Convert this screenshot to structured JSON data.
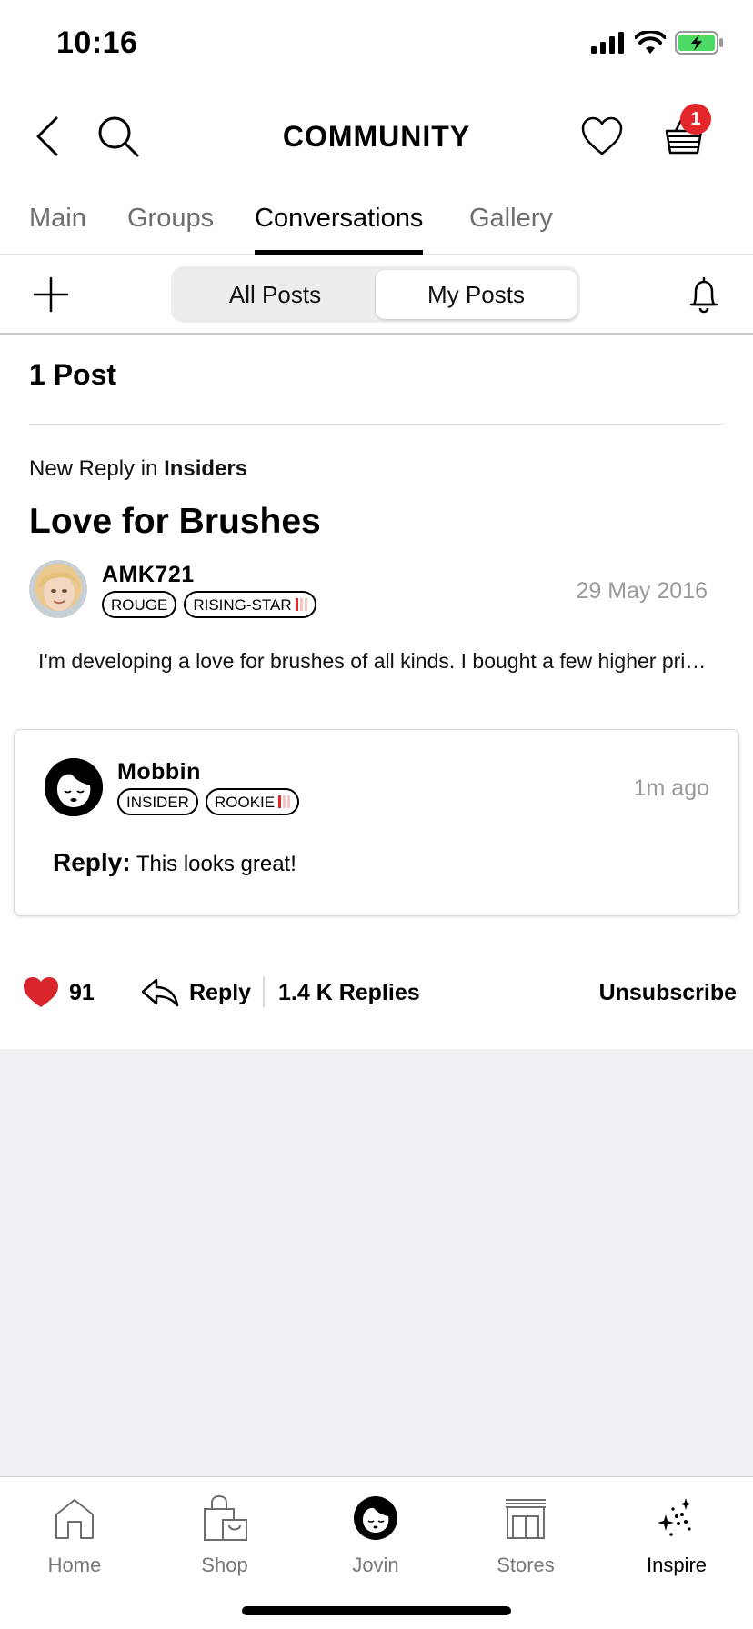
{
  "status_bar": {
    "time": "10:16"
  },
  "header": {
    "title": "COMMUNITY",
    "cart_count": "1"
  },
  "tabs": [
    {
      "label": "Main"
    },
    {
      "label": "Groups"
    },
    {
      "label": "Conversations"
    },
    {
      "label": "Gallery"
    }
  ],
  "active_tab": "Conversations",
  "segmented": {
    "all_posts": "All Posts",
    "my_posts": "My Posts",
    "selected": "My Posts"
  },
  "post_count": "1 Post",
  "post": {
    "context_prefix": "New Reply in",
    "context_group": "Insiders",
    "title": "Love for Brushes",
    "author": "AMK721",
    "badges": [
      "ROUGE",
      "RISING-STAR"
    ],
    "date": "29 May 2016",
    "excerpt": "I'm developing a love for brushes of all kinds. I bought a few higher priced brushes recently and"
  },
  "reply": {
    "author": "Mobbin",
    "badges": [
      "INSIDER",
      "ROOKIE"
    ],
    "time": "1m ago",
    "label": "Reply:",
    "text": "This looks great!"
  },
  "actions": {
    "likes": "91",
    "reply_label": "Reply",
    "replies_count": "1.4 K Replies",
    "unsubscribe": "Unsubscribe"
  },
  "bottom_nav": [
    {
      "label": "Home",
      "icon": "home-icon"
    },
    {
      "label": "Shop",
      "icon": "shopping-bag-icon"
    },
    {
      "label": "Jovin",
      "icon": "profile-avatar-icon"
    },
    {
      "label": "Stores",
      "icon": "store-icon"
    },
    {
      "label": "Inspire",
      "icon": "sparkles-icon"
    }
  ],
  "colors": {
    "accent_red": "#e3262b",
    "grey_bg": "#f1f1f5",
    "muted_text": "#9a9a9a"
  }
}
